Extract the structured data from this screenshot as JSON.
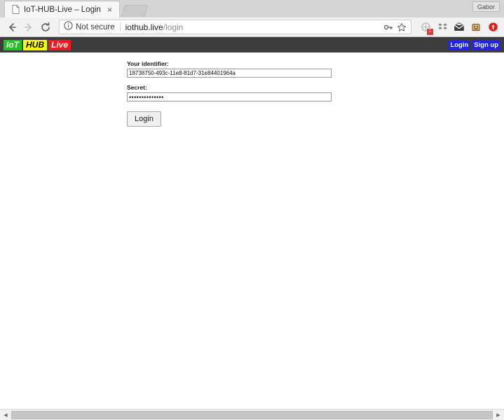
{
  "window": {
    "profile_chip_label": "Gabor"
  },
  "tabs": [
    {
      "title": "IoT-HUB-Live – Login",
      "favicon": "page-icon",
      "close_label": "×"
    }
  ],
  "toolbar": {
    "back_icon": "back-arrow-icon",
    "forward_icon": "forward-arrow-icon",
    "reload_icon": "reload-icon",
    "security_icon": "info-circle-icon",
    "security_label": "Not secure",
    "url_host": "iothub.live",
    "url_path": "/login",
    "key_icon": "key-icon",
    "bookmark_icon": "star-icon",
    "extensions": [
      {
        "name": "extension-badge-icon",
        "glyph": "◌",
        "badge": "1",
        "color": "#b9b9b9"
      },
      {
        "name": "dropbox-icon",
        "glyph": "⁂",
        "badge": "",
        "color": "#8c8c8c"
      },
      {
        "name": "mail-icon",
        "glyph": "✉",
        "badge": "",
        "color": "#3c3c3c"
      },
      {
        "name": "lastpass-icon",
        "glyph": "⬛",
        "badge": "",
        "color": "#e8b96a"
      },
      {
        "name": "opera-red-icon",
        "glyph": "⬆",
        "badge": "",
        "color": "#e21b1b"
      }
    ]
  },
  "site": {
    "brand": {
      "part1": "IoT",
      "part2": "HUB",
      "part3": "Live",
      "color1": "#22c423",
      "color2": "#ffff00",
      "color3": "#f01a20"
    },
    "nav_links": [
      {
        "label": "Login"
      },
      {
        "label": "Sign up"
      }
    ],
    "form": {
      "identifier_label": "Your identifier:",
      "identifier_value": "18738750-493c-11e8-81d7-31e84401964a",
      "identifier_placeholder": "",
      "secret_label": "Secret:",
      "secret_value": "••••••••••••••",
      "secret_placeholder": "",
      "submit_label": "Login"
    }
  },
  "scrollbar": {
    "left_arrow": "◀",
    "right_arrow": "▶"
  }
}
